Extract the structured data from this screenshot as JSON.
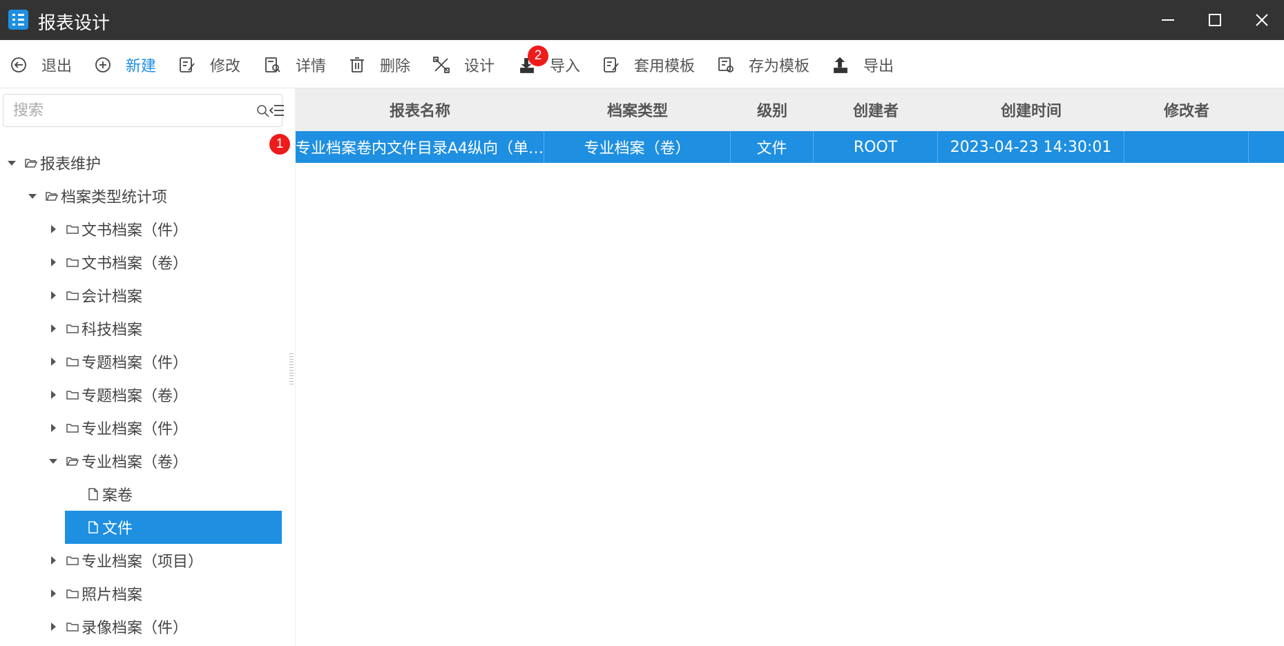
{
  "window": {
    "title": "报表设计",
    "accent_color": "#1e8fe1",
    "titlebar_color": "#333333"
  },
  "toolbar": {
    "items": [
      {
        "label": "退出",
        "icon": "exit-icon"
      },
      {
        "label": "新建",
        "icon": "add-icon"
      },
      {
        "label": "修改",
        "icon": "edit-icon"
      },
      {
        "label": "详情",
        "icon": "details-icon"
      },
      {
        "label": "删除",
        "icon": "delete-icon"
      },
      {
        "label": "设计",
        "icon": "design-icon"
      },
      {
        "label": "导入",
        "icon": "import-icon"
      },
      {
        "label": "套用模板",
        "icon": "apply-template-icon"
      },
      {
        "label": "存为模板",
        "icon": "save-template-icon"
      },
      {
        "label": "导出",
        "icon": "export-icon"
      }
    ]
  },
  "badges": {
    "first": "1",
    "second": "2",
    "color": "#ee1b1b"
  },
  "sidebar": {
    "search_placeholder": "搜索",
    "tree": [
      {
        "label": "报表维护",
        "level": 0,
        "expanded": true,
        "type": "folder"
      },
      {
        "label": "档案类型统计项",
        "level": 1,
        "expanded": true,
        "type": "folder"
      },
      {
        "label": "文书档案（件）",
        "level": 2,
        "expanded": false,
        "type": "folder"
      },
      {
        "label": "文书档案（卷）",
        "level": 2,
        "expanded": false,
        "type": "folder"
      },
      {
        "label": "会计档案",
        "level": 2,
        "expanded": false,
        "type": "folder"
      },
      {
        "label": "科技档案",
        "level": 2,
        "expanded": false,
        "type": "folder"
      },
      {
        "label": "专题档案（件）",
        "level": 2,
        "expanded": false,
        "type": "folder"
      },
      {
        "label": "专题档案（卷）",
        "level": 2,
        "expanded": false,
        "type": "folder"
      },
      {
        "label": "专业档案（件）",
        "level": 2,
        "expanded": false,
        "type": "folder"
      },
      {
        "label": "专业档案（卷）",
        "level": 2,
        "expanded": true,
        "type": "folder"
      },
      {
        "label": "案卷",
        "level": 3,
        "type": "file"
      },
      {
        "label": "文件",
        "level": 3,
        "type": "file",
        "selected": true
      },
      {
        "label": "专业档案（项目）",
        "level": 2,
        "expanded": false,
        "type": "folder"
      },
      {
        "label": "照片档案",
        "level": 2,
        "expanded": false,
        "type": "folder"
      },
      {
        "label": "录像档案（件）",
        "level": 2,
        "expanded": false,
        "type": "folder"
      }
    ]
  },
  "grid": {
    "columns": [
      "报表名称",
      "档案类型",
      "级别",
      "创建者",
      "创建时间",
      "修改者"
    ],
    "rows": [
      [
        "专业档案卷内文件目录A4纵向（单…",
        "专业档案（卷）",
        "文件",
        "ROOT",
        "2023-04-23 14:30:01",
        ""
      ]
    ]
  }
}
